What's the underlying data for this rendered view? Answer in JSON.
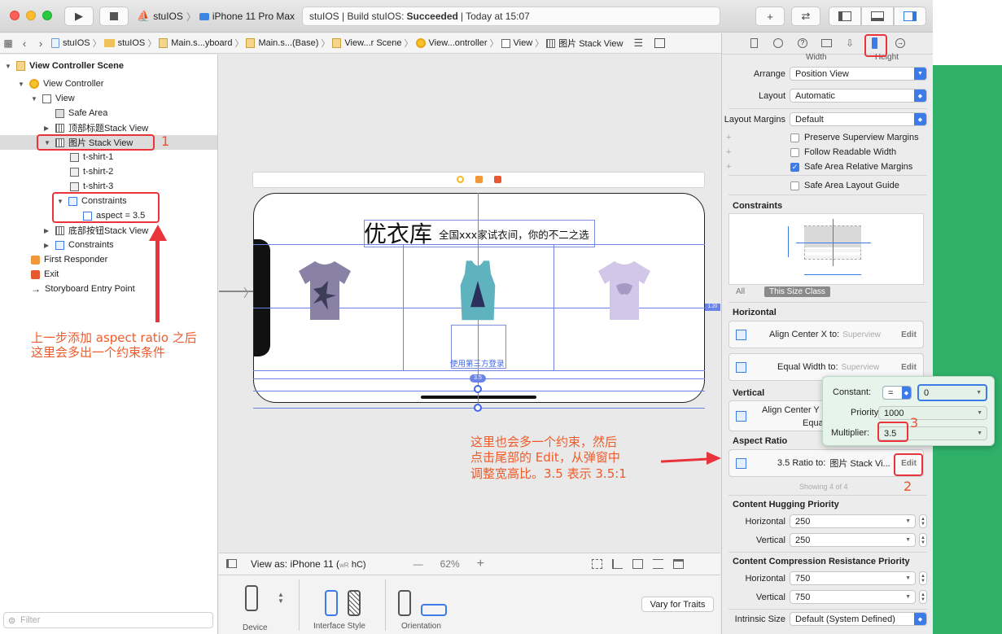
{
  "toolbar": {
    "scheme_name": "stuIOS",
    "device_name": "iPhone 11 Pro Max",
    "activity_prefix": "stuIOS | Build stuIOS:",
    "activity_status": "Succeeded",
    "activity_time": "| Today at 15:07",
    "plus_label": "+",
    "swap_label": "⇄"
  },
  "jumpbar": {
    "items": [
      "stuIOS",
      "stuIOS",
      "Main.s...yboard",
      "Main.s...(Base)",
      "View...r Scene",
      "View...ontroller",
      "View",
      "图片 Stack View"
    ]
  },
  "navigator": {
    "scene_title": "View Controller Scene",
    "view_controller": "View Controller",
    "view": "View",
    "safe_area": "Safe Area",
    "top_stack": "顶部标题Stack View",
    "image_stack": "图片 Stack View",
    "tshirt1": "t-shirt-1",
    "tshirt2": "t-shirt-2",
    "tshirt3": "t-shirt-3",
    "constraints_group": "Constraints",
    "aspect_constraint": "aspect = 3.5",
    "bottom_stack": "底部按钮Stack View",
    "constraints2": "Constraints",
    "first_responder": "First Responder",
    "exit": "Exit",
    "entry_point": "Storyboard Entry Point",
    "filter_placeholder": "Filter"
  },
  "canvas": {
    "app_title": "优衣库",
    "app_subtitle": "全国xxx家试衣间，你的不二之选",
    "third_party_login": "使用第三方登录",
    "view_as": "View as: iPhone 11 (",
    "view_as_traits_w": "wR",
    "view_as_traits_h": "hC)",
    "zoom_level": "62%",
    "zoom_minus": "—",
    "zoom_plus": "+",
    "device_label": "Device",
    "interface_style_label": "Interface Style",
    "orientation_label": "Orientation",
    "vary_for_traits": "Vary for Traits",
    "aspect_badge": "3.5",
    "side_badge": "1.20"
  },
  "annotations": {
    "step1": "1",
    "step2": "2",
    "step3": "3",
    "left_note_line1": "上一步添加 aspect ratio 之后",
    "left_note_line2": "这里会多出一个约束条件",
    "right_note_line1": "这里也会多一个约束，然后",
    "right_note_line2": "点击尾部的 Edit，从弹窗中",
    "right_note_line3": "调整宽高比。3.5 表示 3.5:1"
  },
  "inspector": {
    "width_label": "Width",
    "height_label": "Height",
    "arrange_label": "Arrange",
    "arrange_value": "Position View",
    "layout_label": "Layout",
    "layout_value": "Automatic",
    "layout_margins_label": "Layout Margins",
    "layout_margins_value": "Default",
    "preserve_superview": "Preserve Superview Margins",
    "follow_readable": "Follow Readable Width",
    "safe_area_relative": "Safe Area Relative Margins",
    "safe_area_guide": "Safe Area Layout Guide",
    "constraints_header": "Constraints",
    "tab_all": "All",
    "tab_size_class": "This Size Class",
    "horizontal_header": "Horizontal",
    "align_center_x": "Align Center X to:",
    "align_center_x_target": "Superview",
    "equal_width": "Equal Width to:",
    "equal_width_target": "Superview",
    "vertical_header": "Vertical",
    "align_center_y": "Align Center Y t",
    "equal_partial": "Equa",
    "aspect_ratio_header": "Aspect Ratio",
    "ratio_text": "3.5 Ratio to:",
    "ratio_target": "图片 Stack Vi...",
    "edit_label": "Edit",
    "showing": "Showing 4 of 4",
    "hugging_header": "Content Hugging Priority",
    "hugging_h_label": "Horizontal",
    "hugging_h_value": "250",
    "hugging_v_label": "Vertical",
    "hugging_v_value": "250",
    "compression_header": "Content Compression Resistance Priority",
    "compression_h_label": "Horizontal",
    "compression_h_value": "750",
    "compression_v_label": "Vertical",
    "compression_v_value": "750",
    "intrinsic_label": "Intrinsic Size",
    "intrinsic_value": "Default (System Defined)"
  },
  "popover": {
    "constant_label": "Constant:",
    "relation_value": "=",
    "constant_value": "0",
    "priority_label": "Priority:",
    "priority_value": "1000",
    "multiplier_label": "Multiplier:",
    "multiplier_value": "3.5"
  },
  "colors": {
    "accent_blue": "#3d7be9",
    "annotation_red": "#e8343a",
    "annotation_text": "#f05a28",
    "background_green": "#2fb16a"
  }
}
